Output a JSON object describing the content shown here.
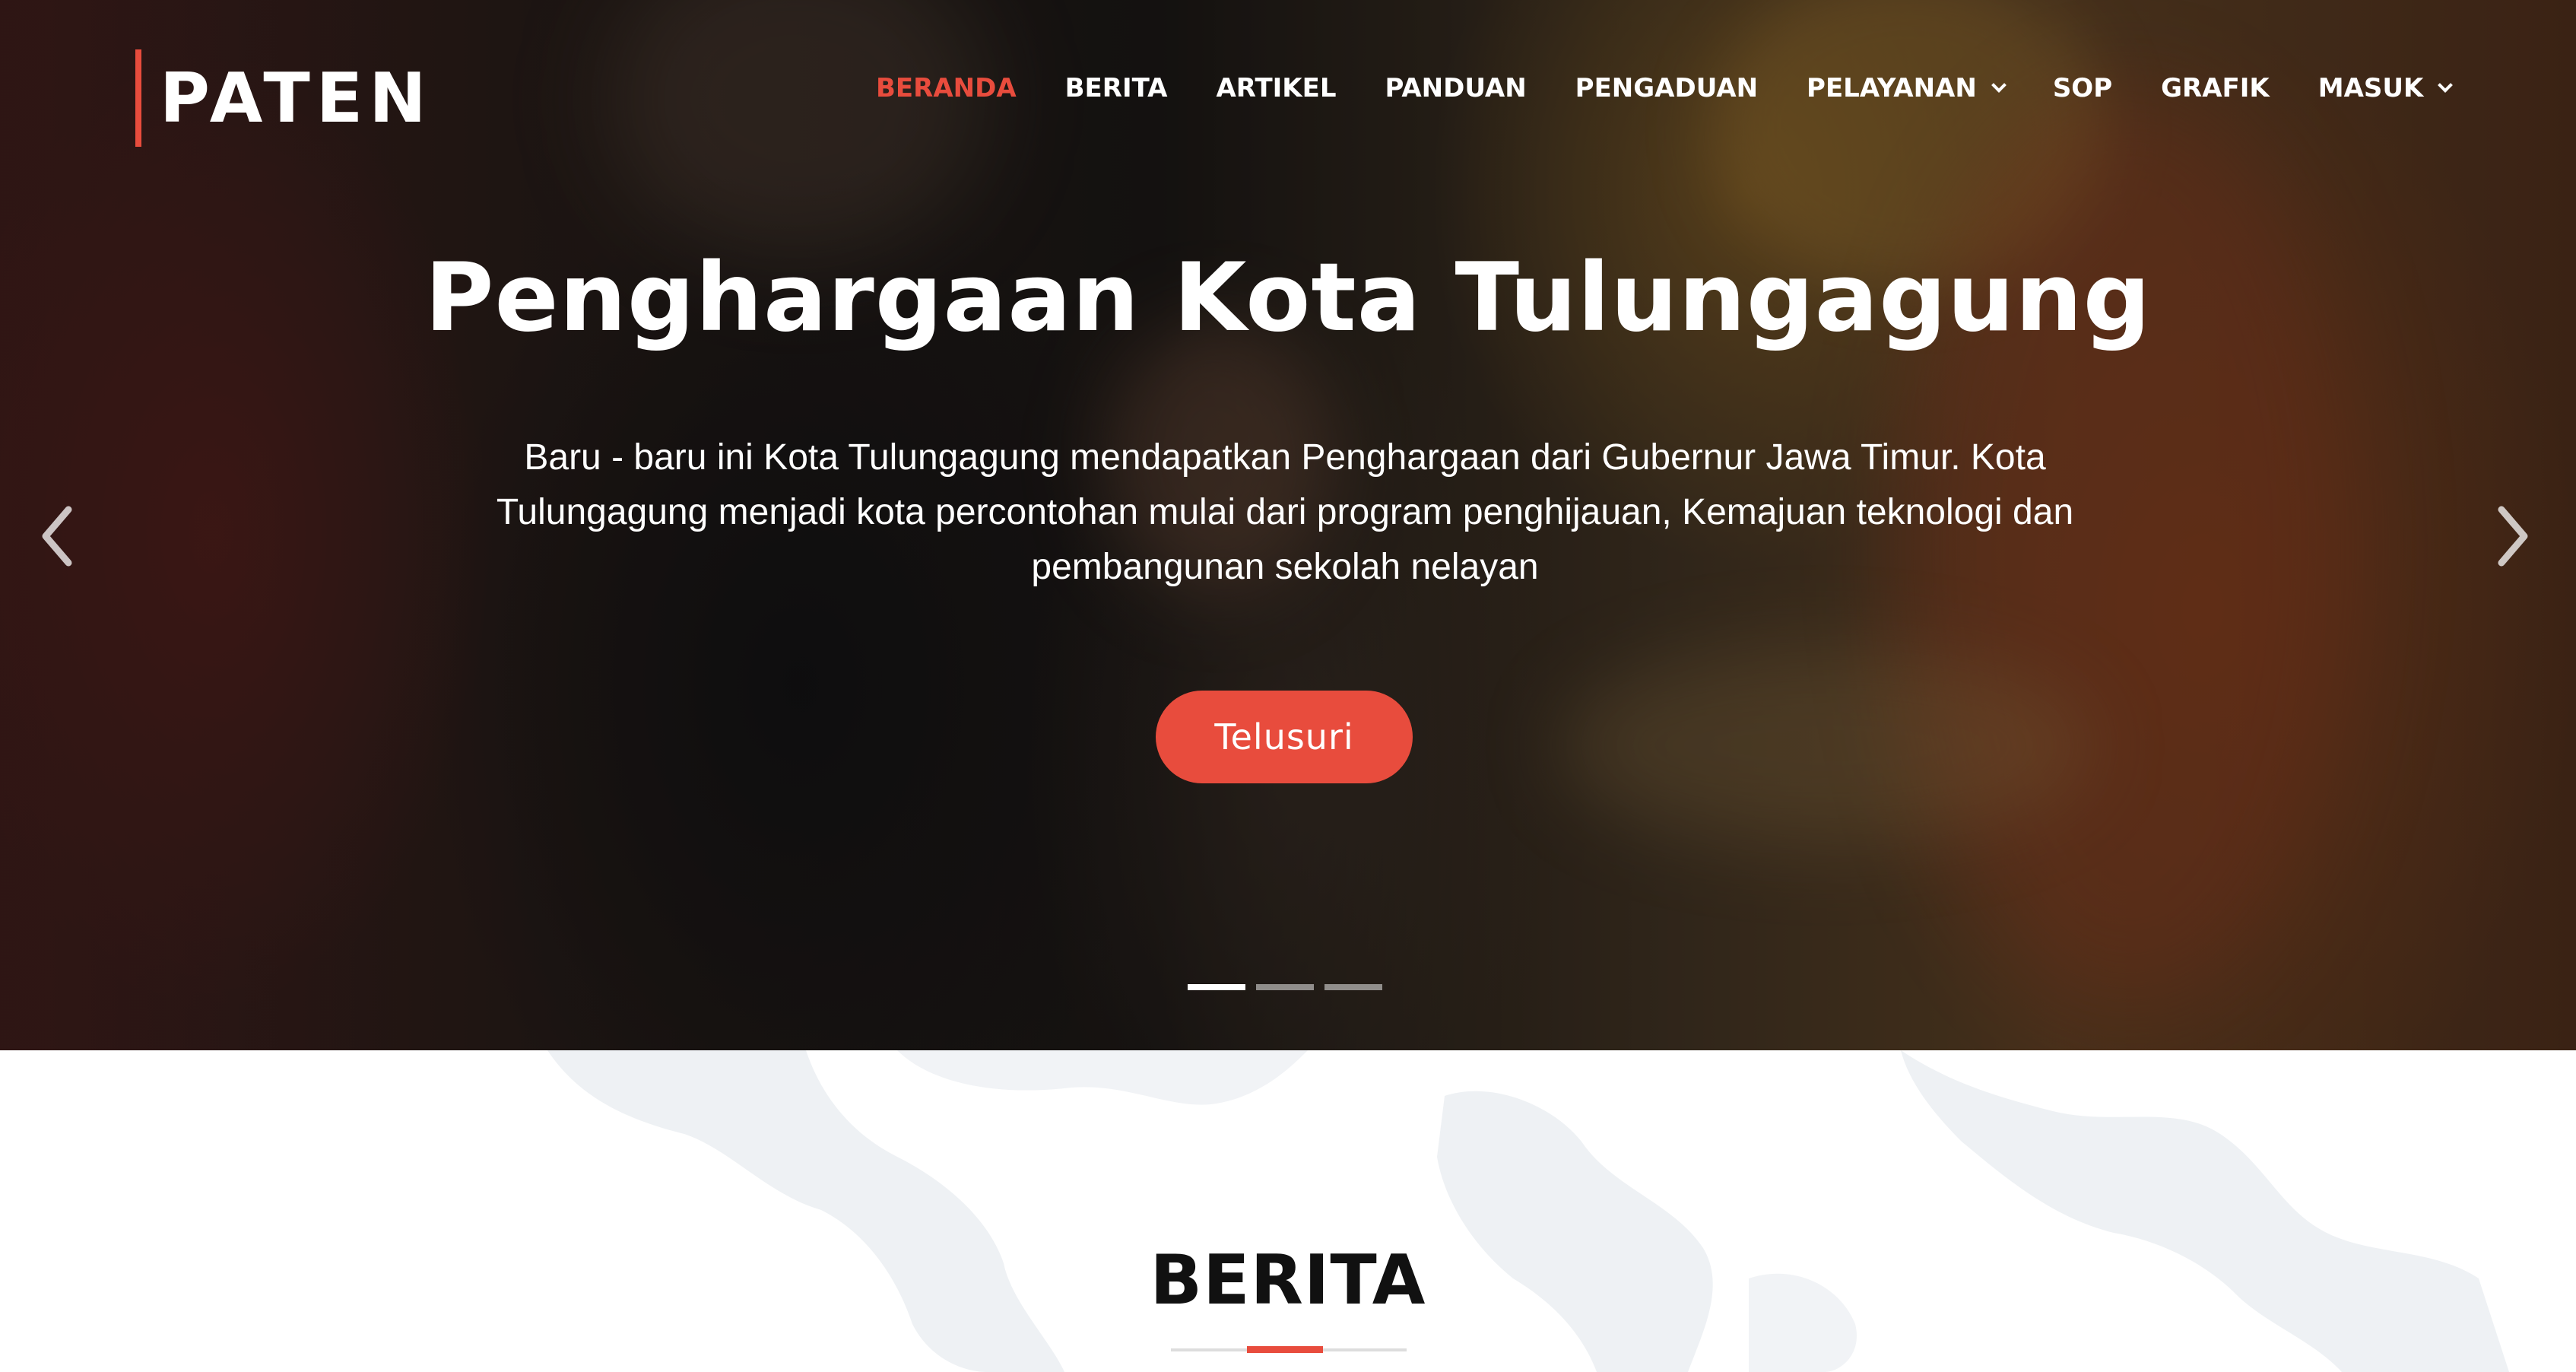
{
  "brand": {
    "logo_text": "PATEN",
    "accent_color": "#e84c3d"
  },
  "nav": {
    "items": [
      {
        "label": "BERANDA",
        "active": true,
        "dropdown": false
      },
      {
        "label": "BERITA",
        "active": false,
        "dropdown": false
      },
      {
        "label": "ARTIKEL",
        "active": false,
        "dropdown": false
      },
      {
        "label": "PANDUAN",
        "active": false,
        "dropdown": false
      },
      {
        "label": "PENGADUAN",
        "active": false,
        "dropdown": false
      },
      {
        "label": "PELAYANAN",
        "active": false,
        "dropdown": true
      },
      {
        "label": "SOP",
        "active": false,
        "dropdown": false
      },
      {
        "label": "GRAFIK",
        "active": false,
        "dropdown": false
      },
      {
        "label": "MASUK",
        "active": false,
        "dropdown": true
      }
    ]
  },
  "hero": {
    "title": "Penghargaan Kota Tulungagung",
    "description": "Baru - baru ini Kota Tulungagung mendapatkan Penghargaan dari Gubernur Jawa Timur. Kota Tulungagung menjadi kota percontohan mulai dari program penghijauan, Kemajuan teknologi dan pembangunan sekolah nelayan",
    "cta_label": "Telusuri",
    "prev_icon": "chevron-left-icon",
    "next_icon": "chevron-right-icon",
    "slides_total": 3,
    "active_slide": 1
  },
  "section": {
    "title": "BERITA"
  }
}
